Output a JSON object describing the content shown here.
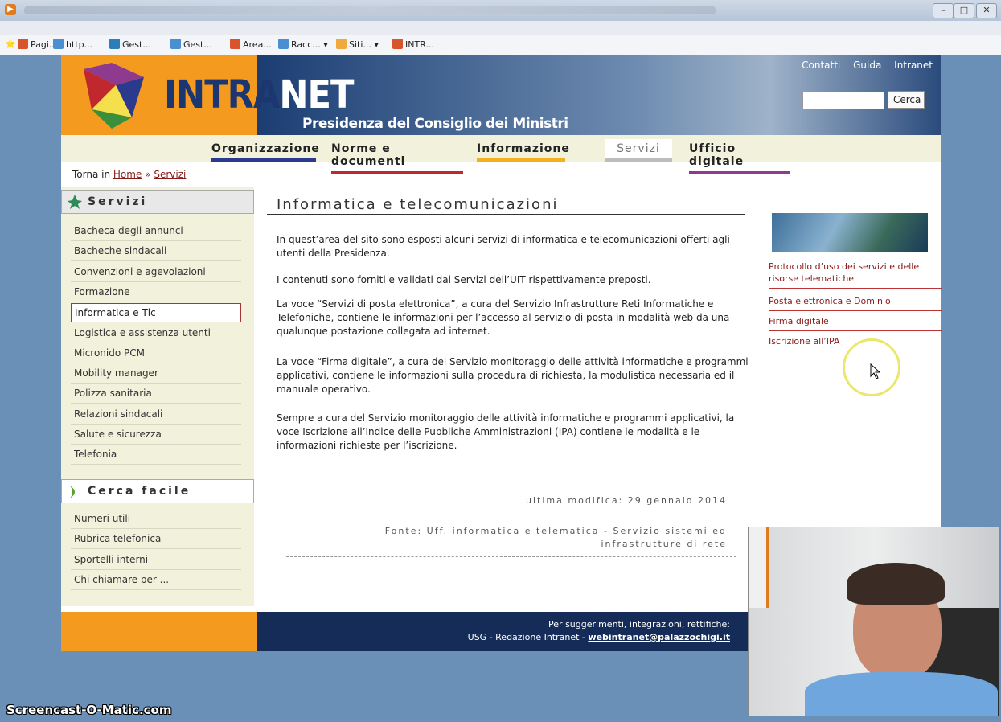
{
  "favorites": [
    {
      "label": "Pagi...",
      "color": "#d9532b"
    },
    {
      "label": "http...",
      "color": "#4a8fd1"
    },
    {
      "label": "Gest...",
      "color": "#2a7fb8"
    },
    {
      "label": "Gest...",
      "color": "#4a8fd1"
    },
    {
      "label": "Area...",
      "color": "#d9532b"
    },
    {
      "label": "Racc... ▾",
      "color": "#4a8fd1"
    },
    {
      "label": "Siti... ▾",
      "color": "#f2a93b"
    },
    {
      "label": "INTR...",
      "color": "#d9532b"
    }
  ],
  "header": {
    "logo_text_a": "INTRA",
    "logo_text_b": "NET",
    "subtitle": "Presidenza del Consiglio dei Ministri",
    "links": [
      "Contatti",
      "Guida",
      "Intranet"
    ],
    "search_button": "Cerca",
    "search_value": ""
  },
  "nav": [
    {
      "label": "Organizzazione",
      "color": "#2b3a8f"
    },
    {
      "label": "Norme e documenti",
      "color": "#c0282d"
    },
    {
      "label": "Informazione",
      "color": "#f2b01e"
    },
    {
      "label": "Servizi",
      "color": "#bdbdbd"
    },
    {
      "label": "Ufficio digitale",
      "color": "#8e3a8e"
    }
  ],
  "breadcrumb": {
    "prefix": "Torna in",
    "home": "Home",
    "sep": "»",
    "current": "Servizi"
  },
  "sidebar": {
    "servizi_title": "Servizi",
    "servizi": [
      "Bacheca degli annunci",
      "Bacheche sindacali",
      "Convenzioni e agevolazioni",
      "Formazione",
      "Informatica e Tlc",
      "Logistica e assistenza utenti",
      "Micronido PCM",
      "Mobility manager",
      "Polizza sanitaria",
      "Relazioni sindacali",
      "Salute e sicurezza",
      "Telefonia"
    ],
    "active_index": 4,
    "cerca_title": "Cerca facile",
    "cerca": [
      "Numeri utili",
      "Rubrica telefonica",
      "Sportelli interni",
      "Chi chiamare per ..."
    ]
  },
  "main": {
    "title": "Informatica e telecomunicazioni",
    "paragraphs": [
      "In quest’area del sito sono esposti alcuni servizi di informatica e telecomunicazioni offerti agli utenti della Presidenza.",
      "I contenuti sono forniti e validati dai Servizi dell’UIT rispettivamente preposti.",
      "La voce “Servizi di posta elettronica”, a cura del Servizio Infrastrutture Reti Informatiche e Telefoniche, contiene le informazioni per l’accesso al servizio di posta in modalità web da una qualunque postazione collegata ad internet.",
      "La voce “Firma digitale”, a cura del Servizio monitoraggio delle attività informatiche e programmi applicativi, contiene le informazioni sulla procedura di richiesta, la modulistica necessaria ed il manuale operativo.",
      "Sempre a cura del Servizio monitoraggio delle attività informatiche e programmi applicativi, la voce Iscrizione all’Indice delle Pubbliche Amministrazioni (IPA) contiene le modalità e le informazioni richieste per l’iscrizione."
    ],
    "last_modified": "ultima modifica: 29 gennaio 2014",
    "source_line1": "Fonte: Uff. informatica e telematica - Servizio sistemi ed",
    "source_line2": "infrastrutture di rete"
  },
  "right_links": [
    "Protocollo d’uso dei servizi e delle risorse telematiche",
    "Posta elettronica e Dominio",
    "Firma digitale",
    "Iscrizione all’IPA"
  ],
  "footer": {
    "line1": "Per suggerimenti, integrazioni, rettifiche:",
    "line2_prefix": "USG - Redazione Intranet -",
    "email": "webintranet@palazzochigi.it"
  },
  "watermark": "Screencast-O-Matic.com"
}
